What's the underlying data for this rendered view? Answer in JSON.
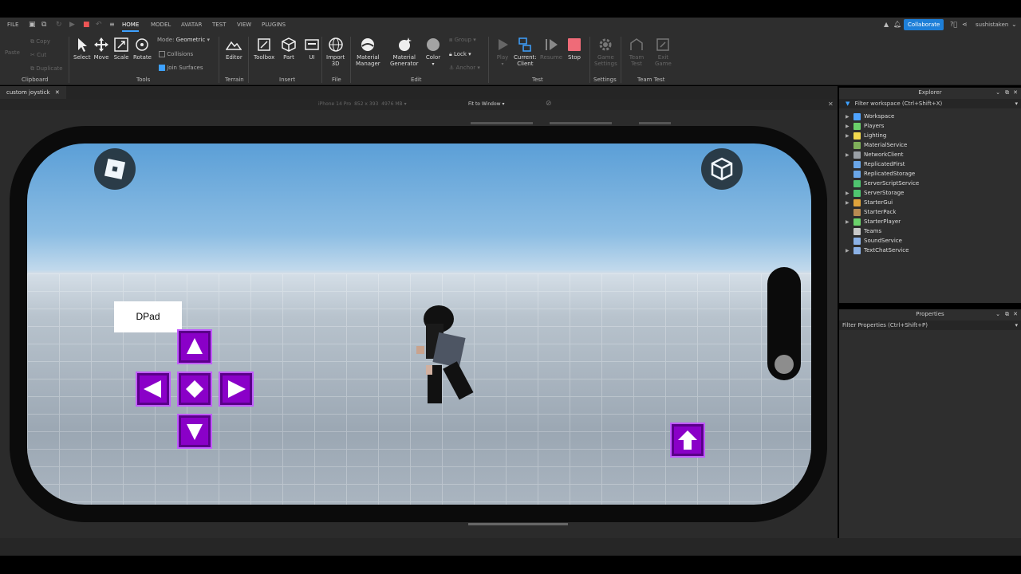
{
  "menu": {
    "file": "FILE",
    "tabs": [
      "HOME",
      "MODEL",
      "AVATAR",
      "TEST",
      "VIEW",
      "PLUGINS"
    ],
    "active": "HOME"
  },
  "header": {
    "collaborate": "Collaborate",
    "user": "sushistaken"
  },
  "ribbon": {
    "clipboard": {
      "paste": "Paste",
      "copy": "Copy",
      "cut": "Cut",
      "duplicate": "Duplicate",
      "label": "Clipboard"
    },
    "tools": {
      "select": "Select",
      "move": "Move",
      "scale": "Scale",
      "rotate": "Rotate",
      "mode_label": "Mode:",
      "mode_value": "Geometric",
      "collisions": "Collisions",
      "join_surfaces": "Join Surfaces",
      "label": "Tools"
    },
    "terrain": {
      "editor": "Editor",
      "label": "Terrain"
    },
    "insert": {
      "toolbox": "Toolbox",
      "part": "Part",
      "ui": "UI",
      "label": "Insert"
    },
    "file": {
      "import3d_1": "Import",
      "import3d_2": "3D",
      "label": "File"
    },
    "edit": {
      "material_manager_1": "Material",
      "material_manager_2": "Manager",
      "material_generator_1": "Material",
      "material_generator_2": "Generator",
      "color": "Color",
      "group": "Group",
      "lock": "Lock",
      "anchor": "Anchor",
      "label": "Edit"
    },
    "test": {
      "play": "Play",
      "current_1": "Current:",
      "current_2": "Client",
      "resume": "Resume",
      "stop": "Stop",
      "label": "Test"
    },
    "settings": {
      "game_1": "Game",
      "game_2": "Settings",
      "label": "Settings"
    },
    "team_test": {
      "team_1": "Team",
      "team_2": "Test",
      "exit_1": "Exit",
      "exit_2": "Game",
      "label": "Team Test"
    }
  },
  "doc_tab": {
    "name": "custom joystick"
  },
  "device": {
    "name": "iPhone 14 Pro",
    "resolution": "852 x 393",
    "memory": "4976 MB",
    "fit": "Fit to Window"
  },
  "game": {
    "dpad_label": "DPad"
  },
  "explorer": {
    "title": "Explorer",
    "filter": "Filter workspace (Ctrl+Shift+X)",
    "items": [
      {
        "name": "Workspace",
        "expandable": true,
        "color": "#4fa3ff"
      },
      {
        "name": "Players",
        "expandable": true,
        "color": "#6bd16b"
      },
      {
        "name": "Lighting",
        "expandable": true,
        "color": "#f2d94e"
      },
      {
        "name": "MaterialService",
        "expandable": false,
        "color": "#7fb05a"
      },
      {
        "name": "NetworkClient",
        "expandable": true,
        "color": "#9aa0a6"
      },
      {
        "name": "ReplicatedFirst",
        "expandable": false,
        "color": "#6aa6e8"
      },
      {
        "name": "ReplicatedStorage",
        "expandable": false,
        "color": "#6aa6e8"
      },
      {
        "name": "ServerScriptService",
        "expandable": false,
        "color": "#4fc46f"
      },
      {
        "name": "ServerStorage",
        "expandable": true,
        "color": "#4fc46f"
      },
      {
        "name": "StarterGui",
        "expandable": true,
        "color": "#e0a33b"
      },
      {
        "name": "StarterPack",
        "expandable": false,
        "color": "#b88a52"
      },
      {
        "name": "StarterPlayer",
        "expandable": true,
        "color": "#6bd16b"
      },
      {
        "name": "Teams",
        "expandable": false,
        "color": "#c8c8c8"
      },
      {
        "name": "SoundService",
        "expandable": false,
        "color": "#8bb1e6"
      },
      {
        "name": "TextChatService",
        "expandable": true,
        "color": "#8bb1e6"
      }
    ]
  },
  "properties": {
    "title": "Properties",
    "filter": "Filter Properties (Ctrl+Shift+P)"
  }
}
